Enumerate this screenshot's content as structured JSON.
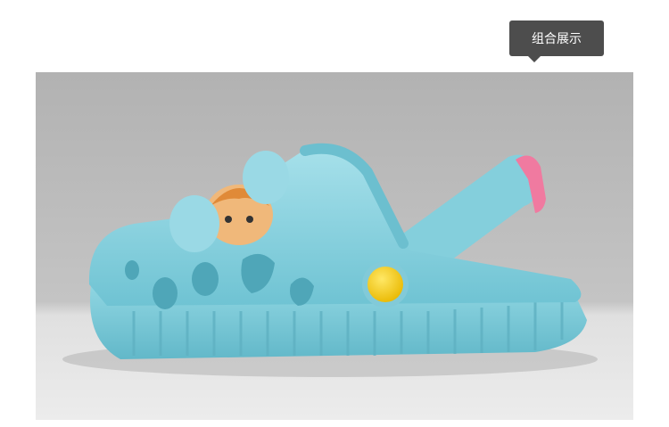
{
  "tooltip": {
    "label": "组合展示"
  },
  "photo": {
    "subject": "sandal-image",
    "colors": {
      "background_top": "#b5b5b5",
      "background_bottom": "#e8e8e8",
      "shoe": "#8ed4e0",
      "button": "#f5d21e",
      "tag": "#f07aa0"
    }
  }
}
